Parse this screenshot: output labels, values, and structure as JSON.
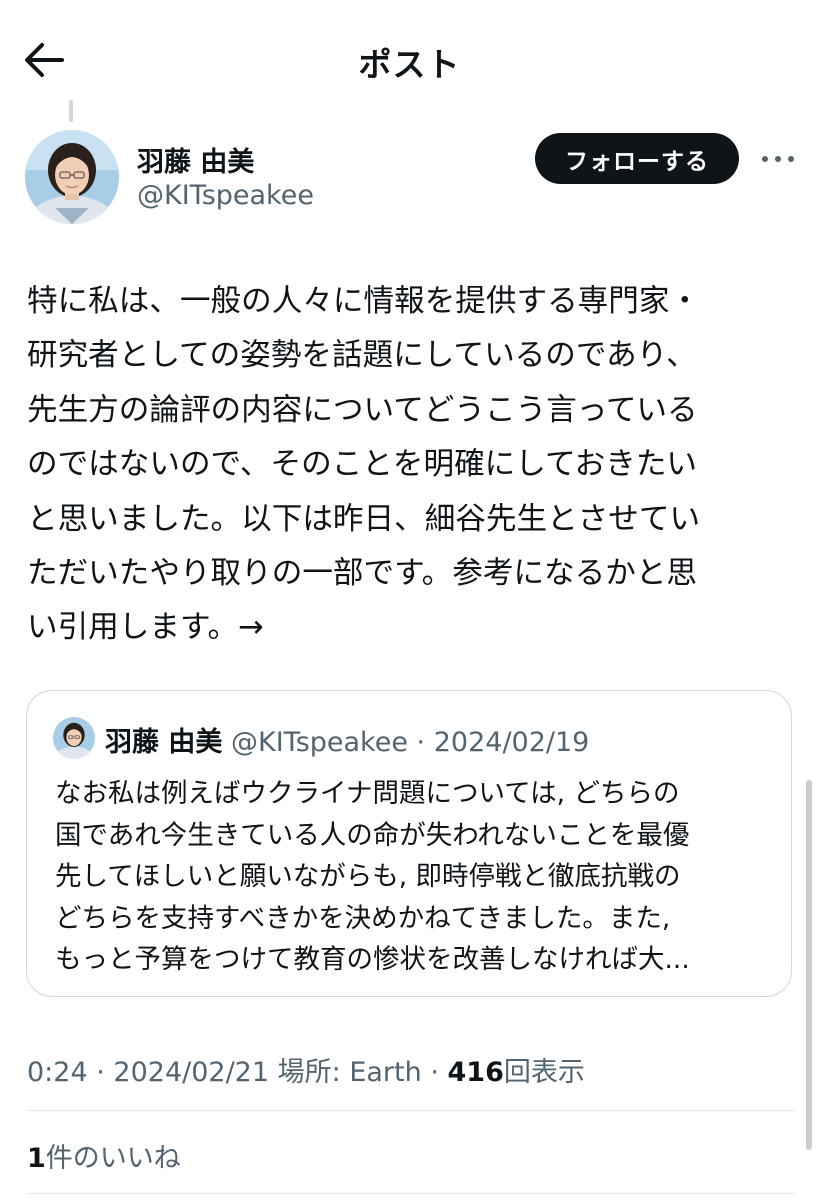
{
  "header": {
    "title": "ポスト",
    "back_icon": "arrow-left-icon"
  },
  "author": {
    "name": "羽藤 由美",
    "handle": "@KITspeakee",
    "avatar_icon": "profile-photo"
  },
  "follow_button": {
    "label": "フォローする"
  },
  "more_icon": "more-horizontal-icon",
  "post": {
    "lines": [
      "特に私は、一般の人々に情報を提供する専門家・",
      "研究者としての姿勢を話題にしているのであり、",
      "先生方の論評の内容についてどうこう言っている",
      "のではないので、そのことを明確にしておきたい",
      "と思いました。以下は昨日、細谷先生とさせてい",
      "ただいたやり取りの一部です。参考になるかと思",
      "い引用します。→"
    ]
  },
  "quote": {
    "name": "羽藤 由美",
    "handle": "@KITspeakee",
    "separator": "·",
    "date": "2024/02/19",
    "lines": [
      "なお私は例えばウクライナ問題については, どちらの",
      "国であれ今生きている人の命が失われないことを最優",
      "先してほしいと願いながらも, 即時停戦と徹底抗戦の",
      "どちらを支持すべきかを決めかねてきました。また,",
      "もっと予算をつけて教育の惨状を改善しなければ大..."
    ]
  },
  "meta": {
    "time": "0:24",
    "sep1": "·",
    "date": "2024/02/21",
    "location": "場所: Earth",
    "sep2": "·",
    "views_count": "416",
    "views_label": "回表示"
  },
  "likes": {
    "count": "1",
    "label": "件のいいね"
  },
  "colors": {
    "text": "#0f1419",
    "muted": "#536471",
    "border": "#cfd9de",
    "button_bg": "#0f1419"
  }
}
